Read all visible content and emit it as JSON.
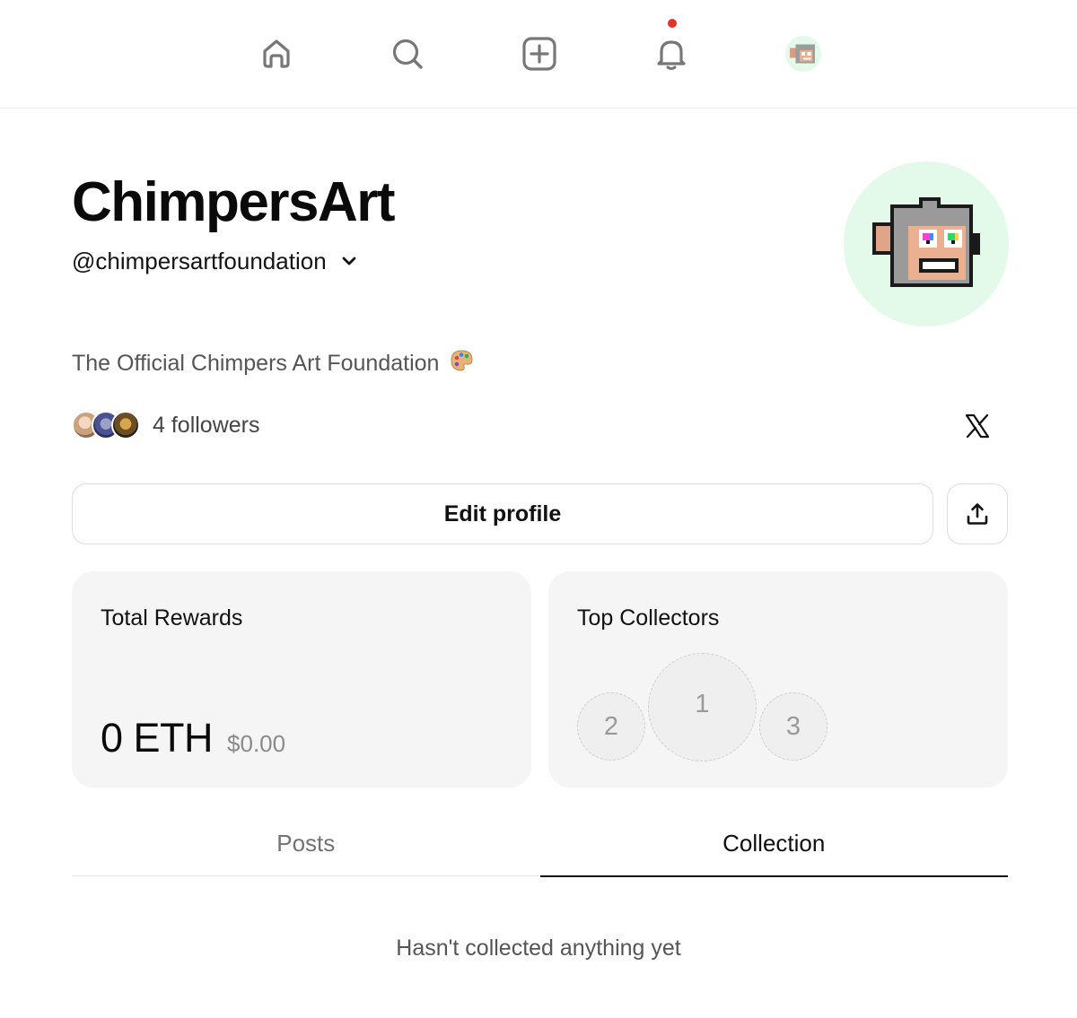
{
  "nav": {
    "items": [
      {
        "icon": "home-icon"
      },
      {
        "icon": "search-icon"
      },
      {
        "icon": "plus-square-icon"
      },
      {
        "icon": "bell-icon",
        "has_notification": true
      },
      {
        "icon": "profile-avatar"
      }
    ],
    "notification_color": "#e5332a"
  },
  "profile": {
    "display_name": "ChimpersArt",
    "handle": "@chimpersartfoundation",
    "bio": "The Official Chimpers Art Foundation",
    "bio_emoji": "palette-emoji",
    "followers_label": "4 followers",
    "social_icon": "x-icon",
    "avatar_bg": "#e3f9ea"
  },
  "actions": {
    "edit_label": "Edit profile",
    "share_icon": "share-icon"
  },
  "rewards": {
    "title": "Total Rewards",
    "amount": "0 ETH",
    "usd": "$0.00"
  },
  "collectors": {
    "title": "Top Collectors",
    "slots": [
      "1",
      "2",
      "3"
    ]
  },
  "tabs": [
    {
      "label": "Posts",
      "active": false
    },
    {
      "label": "Collection",
      "active": true
    }
  ],
  "empty_state": "Hasn't collected anything yet"
}
